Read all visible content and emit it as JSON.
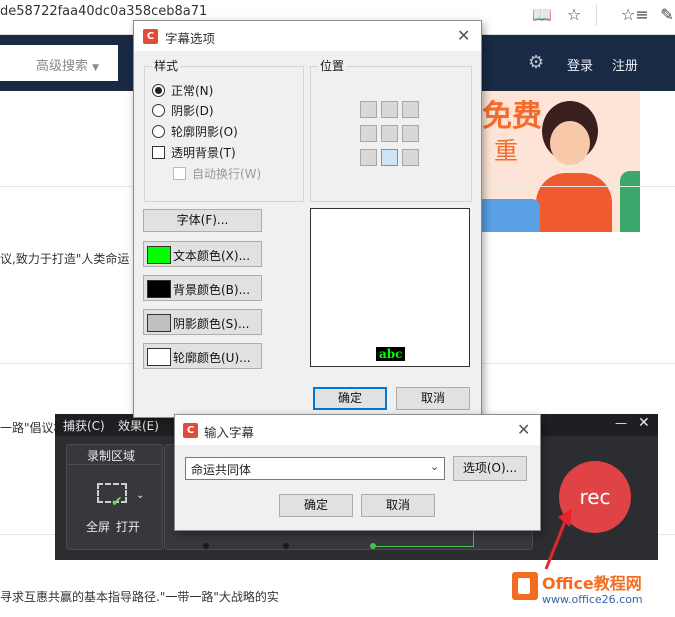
{
  "browser": {
    "url_fragment": "de58722faa40dc0a358ceb8a71",
    "icons": [
      "reader-mode-icon",
      "favorite-star-icon",
      "favorites-list-icon",
      "pen-icon"
    ]
  },
  "site": {
    "advanced_search": "高级搜索",
    "login": "登录",
    "register": "注册",
    "banner_text_1": "免费",
    "banner_text_2": "重"
  },
  "page_snippets": [
    "议,致力于打造\"人类命运",
    "一路\"倡议相",
    "寻求互惠共赢的基本指导路径.\"一带一路\"大战略的实"
  ],
  "subtitle_dialog": {
    "title": "字幕选项",
    "style_group": "样式",
    "options": [
      "正常(N)",
      "阴影(D)",
      "轮廓阴影(O)"
    ],
    "transparent_bg": "透明背景(T)",
    "auto_wrap": "自动换行(W)",
    "position_group": "位置",
    "font_button": "字体(F)...",
    "color_buttons": [
      {
        "label": "文本颜色(X)...",
        "color": "#00ff00"
      },
      {
        "label": "背景颜色(B)...",
        "color": "#000000"
      },
      {
        "label": "阴影颜色(S)...",
        "color": "#c0c0c0"
      },
      {
        "label": "轮廓颜色(U)...",
        "color": "#ffffff"
      }
    ],
    "preview_text": "abc",
    "ok": "确定",
    "cancel": "取消"
  },
  "recorder": {
    "menu": [
      "捕获(C)",
      "效果(E)"
    ],
    "region_label": "录制区域",
    "fullscreen": "全屏",
    "open": "打开",
    "rec": "rec"
  },
  "input_dialog": {
    "title": "输入字幕",
    "text_value": "命运共同体",
    "options_button": "选项(O)...",
    "ok": "确定",
    "cancel": "取消"
  },
  "watermark": {
    "brand": "Office教程网",
    "url": "www.office26.com"
  }
}
